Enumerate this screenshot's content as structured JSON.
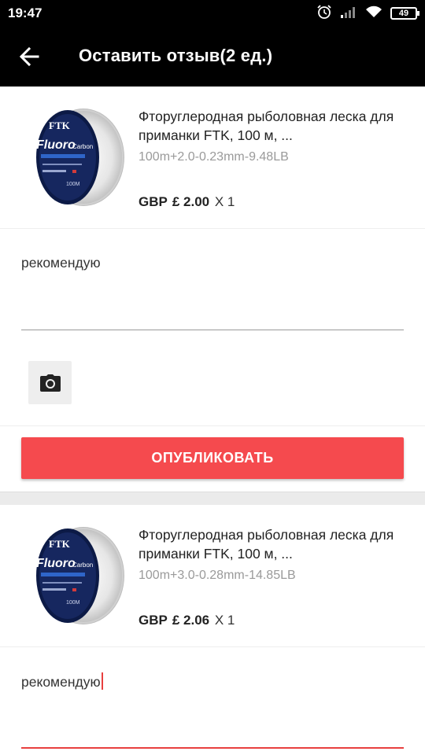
{
  "status_bar": {
    "time": "19:47",
    "battery": "49",
    "icons": [
      "alarm-icon",
      "signal-icon",
      "wifi-icon",
      "battery-icon"
    ]
  },
  "app_bar": {
    "back_icon": "arrow-left-icon",
    "title": "Оставить отзыв(2 ед.)"
  },
  "reviews": [
    {
      "product": {
        "title": "Фторуглеродная рыболовная леска для приманки FTK, 100 м, ...",
        "variant": "100m+2.0-0.23mm-9.48LB",
        "currency": "GBP",
        "price": "£ 2.00",
        "qty": "X 1",
        "image_text": [
          "FTK",
          "Fluoro",
          "Carbon",
          "100M"
        ]
      },
      "review_text": "рекомендую",
      "camera_icon": "camera-icon",
      "publish_label": "ОПУБЛИКОВАТЬ"
    },
    {
      "product": {
        "title": "Фторуглеродная рыболовная леска для приманки FTK, 100 м, ...",
        "variant": "100m+3.0-0.28mm-14.85LB",
        "currency": "GBP",
        "price": "£ 2.06",
        "qty": "X 1",
        "image_text": [
          "FTK",
          "Fluoro",
          "Carbon",
          "100M"
        ]
      },
      "review_text": "рекомендую"
    }
  ],
  "colors": {
    "accent": "#f54a4e",
    "focus_underline": "#e8403f",
    "bar_background": "#000000"
  }
}
